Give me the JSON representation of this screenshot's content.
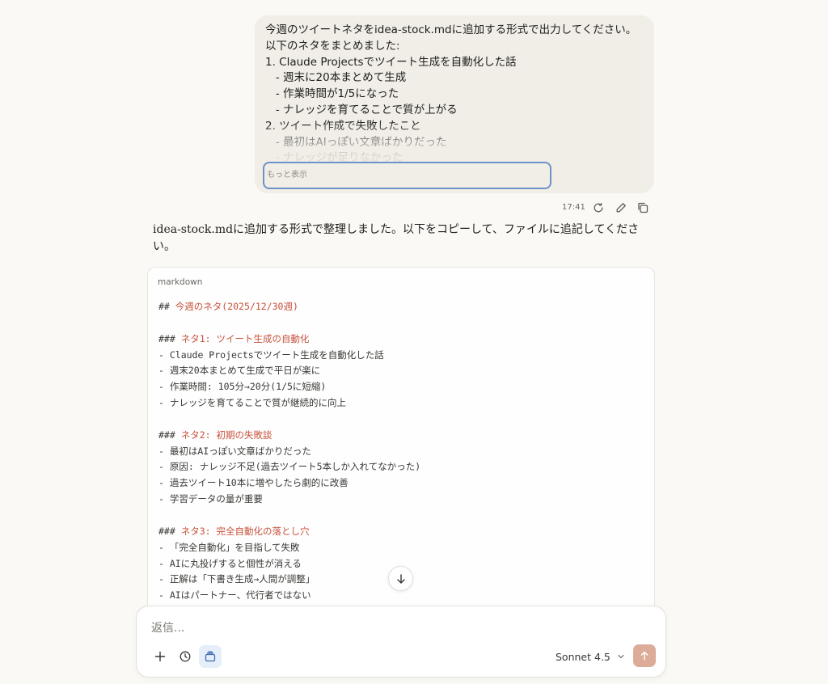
{
  "user_message": {
    "lines": [
      "今週のツイートネタをidea-stock.mdに追加する形式で出力してください。",
      "以下のネタをまとめました:",
      "1. Claude Projectsでツイート生成を自動化した話",
      "   - 週末に20本まとめて生成",
      "   - 作業時間が1/5になった",
      "   - ナレッジを育てることで質が上がる",
      "2. ツイート作成で失敗したこと",
      "   - 最初はAIっぽい文章ばかりだった",
      "   - ナレッジが足りなかった"
    ],
    "show_more_label": "もっと表示",
    "timestamp": "17:41"
  },
  "meta_icons": [
    "retry-icon",
    "edit-icon",
    "copy-icon"
  ],
  "assistant": {
    "intro": "idea-stock.mdに追加する形式で整理しました。以下をコピーして、ファイルに追記してください。",
    "code_language": "markdown",
    "code_lines": [
      {
        "prefix": "## ",
        "heading": "今週のネタ(2025/12/30週)",
        "text": ""
      },
      {
        "prefix": "",
        "heading": "",
        "text": ""
      },
      {
        "prefix": "### ",
        "heading": "ネタ1: ツイート生成の自動化",
        "text": ""
      },
      {
        "prefix": "",
        "heading": "",
        "text": "- Claude Projectsでツイート生成を自動化した話"
      },
      {
        "prefix": "",
        "heading": "",
        "text": "- 週末20本まとめて生成で平日が楽に"
      },
      {
        "prefix": "",
        "heading": "",
        "text": "- 作業時間: 105分→20分(1/5に短縮)"
      },
      {
        "prefix": "",
        "heading": "",
        "text": "- ナレッジを育てることで質が継続的に向上"
      },
      {
        "prefix": "",
        "heading": "",
        "text": ""
      },
      {
        "prefix": "### ",
        "heading": "ネタ2: 初期の失敗談",
        "text": ""
      },
      {
        "prefix": "",
        "heading": "",
        "text": "- 最初はAIっぽい文章ばかりだった"
      },
      {
        "prefix": "",
        "heading": "",
        "text": "- 原因: ナレッジ不足(過去ツイート5本しか入れてなかった)"
      },
      {
        "prefix": "",
        "heading": "",
        "text": "- 過去ツイート10本に増やしたら劇的に改善"
      },
      {
        "prefix": "",
        "heading": "",
        "text": "- 学習データの量が重要"
      },
      {
        "prefix": "",
        "heading": "",
        "text": ""
      },
      {
        "prefix": "### ",
        "heading": "ネタ3: 完全自動化の落とし穴",
        "text": ""
      },
      {
        "prefix": "",
        "heading": "",
        "text": "- 「完全自動化」を目指して失敗"
      },
      {
        "prefix": "",
        "heading": "",
        "text": "- AIに丸投げすると個性が消える"
      },
      {
        "prefix": "",
        "heading": "",
        "text": "- 正解は「下書き生成→人間が調整」"
      },
      {
        "prefix": "",
        "heading": "",
        "text": "- AIはパートナー、代行者ではない"
      }
    ]
  },
  "composer": {
    "placeholder": "返信...",
    "model_label": "Sonnet 4.5"
  },
  "colors": {
    "background": "#faf9f5",
    "user_bubble": "#f0eee6",
    "heading_accent": "#c7513a",
    "send_button": "#ddac98",
    "focus_ring": "#6d93c7"
  }
}
